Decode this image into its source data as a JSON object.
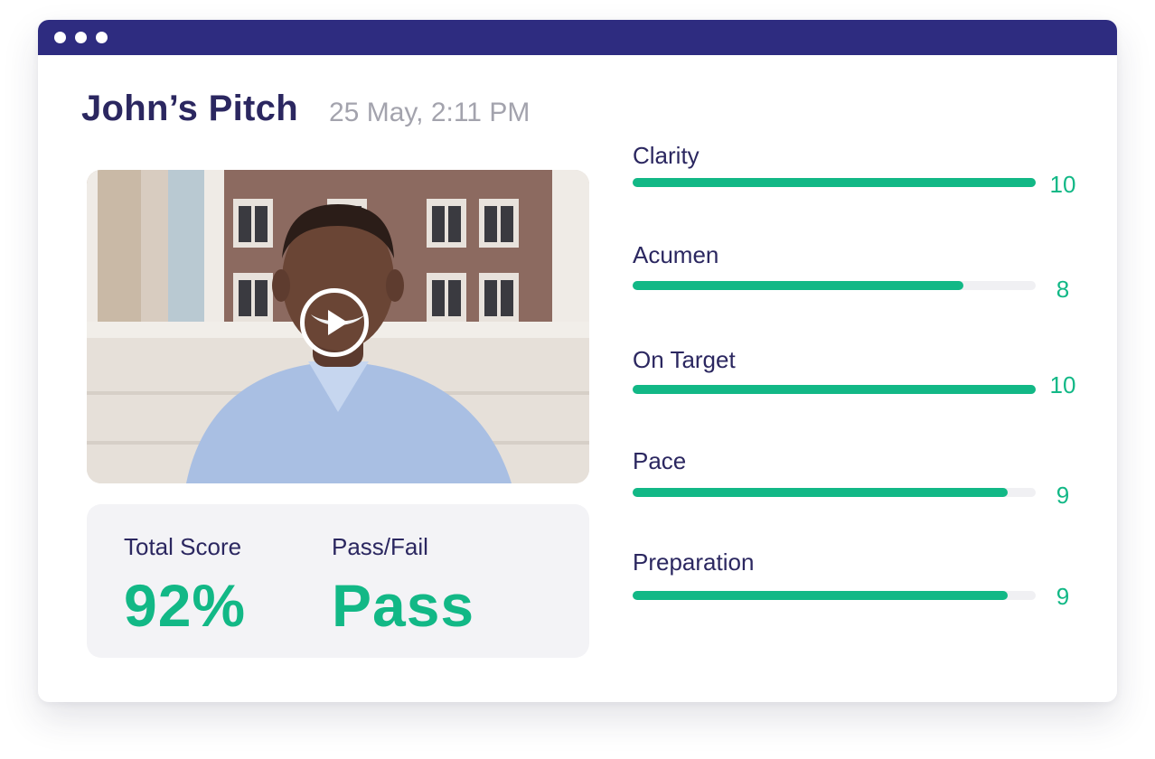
{
  "header": {
    "title": "John’s Pitch",
    "date": "25 May, 2:11 PM"
  },
  "video": {
    "play_icon": "play-icon"
  },
  "summary": {
    "total_score_label": "Total Score",
    "total_score_value": "92%",
    "pass_fail_label": "Pass/Fail",
    "pass_fail_value": "Pass"
  },
  "metrics": [
    {
      "label": "Clarity",
      "value": "10",
      "score": 10,
      "max": 10
    },
    {
      "label": "Acumen",
      "value": "8",
      "score": 8.2,
      "max": 10
    },
    {
      "label": "On Target",
      "value": "10",
      "score": 10,
      "max": 10
    },
    {
      "label": "Pace",
      "value": "9",
      "score": 9.3,
      "max": 10
    },
    {
      "label": "Preparation",
      "value": "9",
      "score": 9.3,
      "max": 10
    }
  ],
  "colors": {
    "titlebar": "#2e2c80",
    "accent": "#12b886",
    "text": "#2b2760",
    "muted": "#a3a3ad"
  }
}
